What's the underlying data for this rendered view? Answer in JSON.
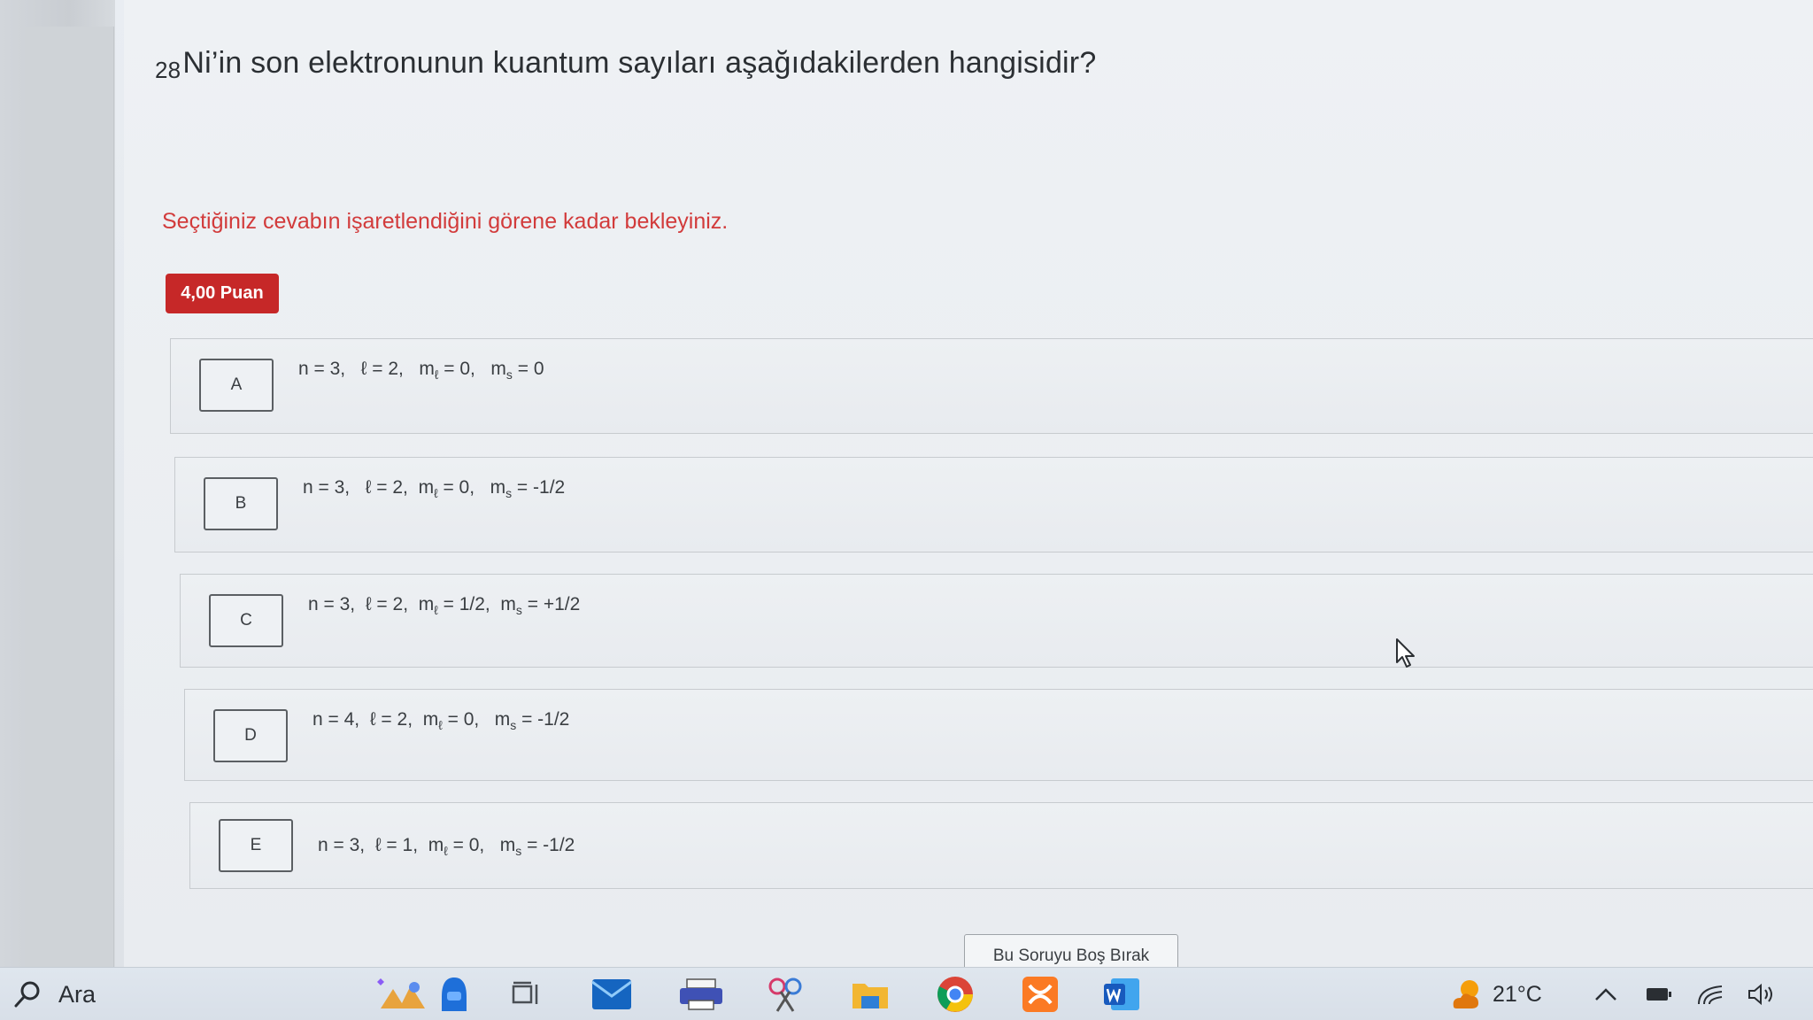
{
  "question": {
    "subscript": "28",
    "text": "Ni’in son elektronunun kuantum sayıları aşağıdakilerden hangisidir?"
  },
  "warning": "Seçtiğiniz cevabın işaretlendiğini görene kadar bekleyiniz.",
  "points_badge": "4,00 Puan",
  "options": [
    {
      "letter": "A",
      "n": "n = 3,",
      "l": "ℓ = 2,",
      "ml": "= 0,",
      "ms": "= 0"
    },
    {
      "letter": "B",
      "n": "n = 3,",
      "l": "ℓ = 2,",
      "ml": "= 0,",
      "ms": "= -1/2"
    },
    {
      "letter": "C",
      "n": "n = 3,",
      "l": "ℓ = 2,",
      "ml": "= 1/2,",
      "ms": "= +1/2"
    },
    {
      "letter": "D",
      "n": "n = 4,",
      "l": "ℓ = 2,",
      "ml": "= 0,",
      "ms": "= -1/2"
    },
    {
      "letter": "E",
      "n": "n = 3,",
      "l": "ℓ = 1,",
      "ml": "= 0,",
      "ms": "= -1/2"
    }
  ],
  "symbols": {
    "m": "m",
    "ml_sub": "ℓ",
    "ms_sub": "s"
  },
  "skip_button": "Bu Soruyu Boş Bırak",
  "taskbar": {
    "search_label": "Ara",
    "temperature": "21°C"
  },
  "colors": {
    "warning": "#d23b3b",
    "badge": "#c62828"
  }
}
